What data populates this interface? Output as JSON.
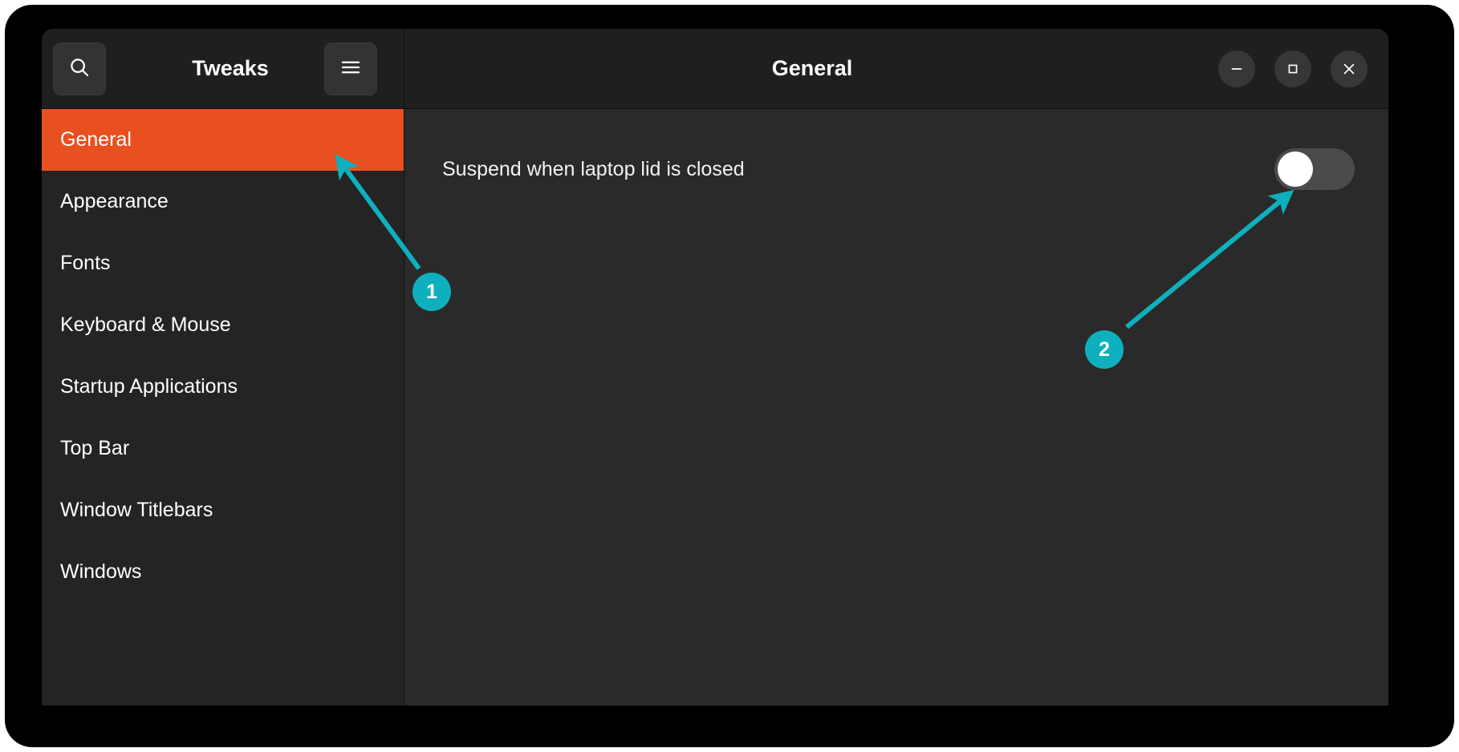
{
  "window": {
    "app_title": "Tweaks",
    "page_title": "General",
    "controls": [
      {
        "name": "minimize",
        "glyph": "—"
      },
      {
        "name": "maximize",
        "glyph": "□"
      },
      {
        "name": "close",
        "glyph": "✕"
      }
    ],
    "search_icon": "search-icon",
    "menu_icon": "hamburger-menu-icon"
  },
  "sidebar": {
    "items": [
      {
        "label": "General",
        "selected": true
      },
      {
        "label": "Appearance",
        "selected": false
      },
      {
        "label": "Fonts",
        "selected": false
      },
      {
        "label": "Keyboard & Mouse",
        "selected": false
      },
      {
        "label": "Startup Applications",
        "selected": false
      },
      {
        "label": "Top Bar",
        "selected": false
      },
      {
        "label": "Window Titlebars",
        "selected": false
      },
      {
        "label": "Windows",
        "selected": false
      }
    ]
  },
  "content": {
    "settings": [
      {
        "label": "Suspend when laptop lid is closed",
        "toggle_state": "off"
      }
    ]
  },
  "annotations": {
    "accent_color": "#0fb0bd",
    "steps": [
      {
        "number": "1",
        "target": "sidebar-item-general"
      },
      {
        "number": "2",
        "target": "suspend-lid-toggle"
      }
    ]
  },
  "colors": {
    "selection_orange": "#e8511f",
    "sidebar_bg": "#242424",
    "content_bg": "#2a2a2a",
    "header_bg": "#1f1f1f",
    "frame_black": "#000000"
  }
}
